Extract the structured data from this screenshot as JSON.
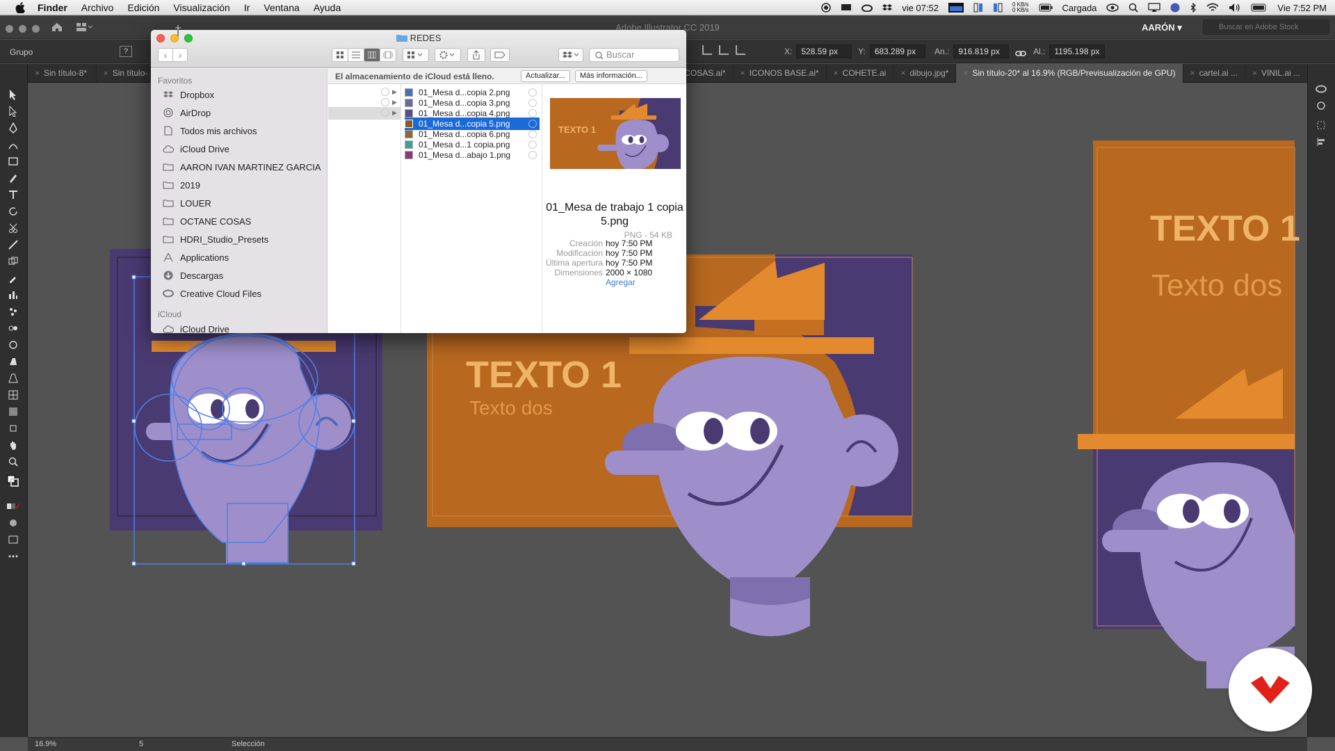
{
  "menubar": {
    "app": "Finder",
    "items": [
      "Archivo",
      "Edición",
      "Visualización",
      "Ir",
      "Ventana",
      "Ayuda"
    ],
    "status_date": "vie 07:52",
    "net_up": "0 KB/s",
    "net_down": "0 KB/s",
    "battery_label": "Cargada",
    "clock": "Vie 7:52 PM"
  },
  "illustrator": {
    "window_title": "Adobe Illustrator CC 2019",
    "workspace": "AARÓN",
    "stock_search_placeholder": "Buscar en Adobe Stock",
    "selection_label": "Grupo",
    "x_label": "X:",
    "x_value": "528.59 px",
    "y_label": "Y:",
    "y_value": "683.289 px",
    "w_label": "An.:",
    "w_value": "916.819 px",
    "h_label": "Al.:",
    "h_value": "1195.198 px",
    "tabs": [
      {
        "label": "Sin título-8*"
      },
      {
        "label": "Sin título-"
      },
      {
        "label": "COSAS.ai*"
      },
      {
        "label": "ICONOS BASE.ai*"
      },
      {
        "label": "COHETE.ai"
      },
      {
        "label": "dibujo.jpg*"
      },
      {
        "label": "Sin título-20* al 16.9% (RGB/Previsualización de GPU)"
      },
      {
        "label": "cartel.ai ..."
      },
      {
        "label": "VINIL.ai ..."
      }
    ],
    "status": {
      "zoom": "16.9%",
      "page": "5",
      "mode": "Selección"
    },
    "artwork": {
      "text_main": "TEXTO 1",
      "text_sub": "Texto dos",
      "text_main_right": "TEXTO 1",
      "text_sub_right": "Texto dos"
    }
  },
  "finder": {
    "title": "REDES",
    "search_placeholder": "Buscar",
    "sidebar": {
      "favorites_header": "Favoritos",
      "items": [
        {
          "label": "Dropbox",
          "icon": "dropbox-icon"
        },
        {
          "label": "AirDrop",
          "icon": "airdrop-icon"
        },
        {
          "label": "Todos mis archivos",
          "icon": "all-files-icon"
        },
        {
          "label": "iCloud Drive",
          "icon": "cloud-icon"
        },
        {
          "label": "AARON IVAN MARTINEZ GARCIA",
          "icon": "folder-icon"
        },
        {
          "label": "2019",
          "icon": "folder-icon"
        },
        {
          "label": "LOUER",
          "icon": "folder-icon"
        },
        {
          "label": "OCTANE COSAS",
          "icon": "folder-icon"
        },
        {
          "label": "HDRI_Studio_Presets",
          "icon": "folder-icon"
        },
        {
          "label": "Applications",
          "icon": "applications-icon"
        },
        {
          "label": "Descargas",
          "icon": "downloads-icon"
        },
        {
          "label": "Creative Cloud Files",
          "icon": "creative-cloud-icon"
        }
      ],
      "icloud_header": "iCloud",
      "icloud_item": "iCloud Drive"
    },
    "banner": {
      "message": "El almacenamiento de iCloud está lleno.",
      "update_button": "Actualizar...",
      "more_button": "Más información..."
    },
    "files": [
      {
        "name": "01_Mesa d...copia 2.png",
        "selected": false,
        "thumb": "#4a6fb5"
      },
      {
        "name": "01_Mesa d...copia 3.png",
        "selected": false,
        "thumb": "#6a6aa0"
      },
      {
        "name": "01_Mesa d...copia 4.png",
        "selected": false,
        "thumb": "#5a4a8a"
      },
      {
        "name": "01_Mesa d...copia 5.png",
        "selected": true,
        "thumb": "#8a5a2a"
      },
      {
        "name": "01_Mesa d...copia 6.png",
        "selected": false,
        "thumb": "#8a6a3a"
      },
      {
        "name": "01_Mesa d...1 copia.png",
        "selected": false,
        "thumb": "#3aa0a0"
      },
      {
        "name": "01_Mesa d...abajo 1.png",
        "selected": false,
        "thumb": "#8a3a7a"
      }
    ],
    "preview": {
      "name": "01_Mesa de trabajo 1 copia 5.png",
      "kind": "PNG - 54 KB",
      "thumb_text": "TEXTO 1",
      "creation_label": "Creación",
      "creation": "hoy 7:50 PM",
      "modified_label": "Modificación",
      "modified": "hoy 7:50 PM",
      "opened_label": "Última apertura",
      "opened": "hoy 7:50 PM",
      "dims_label": "Dimensiones",
      "dims": "2000 × 1080",
      "add_link": "Agregar"
    }
  },
  "colors": {
    "orange": "#e38a2e",
    "dark_orange": "#b8681f",
    "purple_dark": "#4a3a72",
    "face": "#9e8fcb",
    "face_dark": "#7e6fae",
    "canvas": "#535353",
    "finder_selection": "#1c6ad8",
    "logo_red": "#e0221b"
  }
}
